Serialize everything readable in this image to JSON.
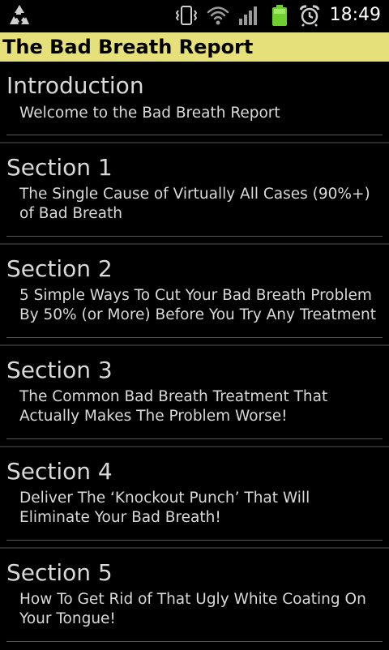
{
  "status_bar": {
    "time": "18:49",
    "icons": [
      "recycle-icon",
      "vibrate-icon",
      "wifi-icon",
      "signal-icon",
      "battery-icon",
      "alarm-icon"
    ]
  },
  "app": {
    "title": "The Bad Breath Report",
    "title_bar_color": "#e6e07a"
  },
  "sections": [
    {
      "title": "Introduction",
      "description": "Welcome to the Bad Breath Report"
    },
    {
      "title": "Section 1",
      "description": "The Single Cause of Virtually All Cases (90%+) of Bad Breath"
    },
    {
      "title": "Section 2",
      "description": "5 Simple Ways To Cut Your Bad Breath Problem By 50% (or More) Before You Try Any Treatment"
    },
    {
      "title": "Section 3",
      "description": "The Common Bad Breath Treatment That Actually Makes The Problem Worse!"
    },
    {
      "title": "Section 4",
      "description": "Deliver The ‘Knockout Punch’ That Will Eliminate Your Bad Breath!"
    },
    {
      "title": "Section 5",
      "description": "How To Get Rid of That Ugly White Coating On Your Tongue!"
    }
  ]
}
